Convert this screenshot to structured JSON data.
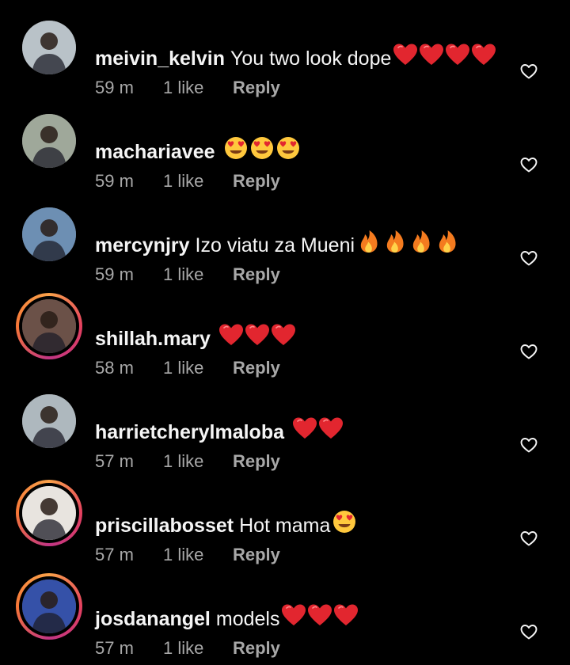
{
  "comments": [
    {
      "username": "meivin_kelvin",
      "text": "You two look dope",
      "emoji": "heart",
      "emoji_count": 4,
      "time": "59 m",
      "likes": "1 like",
      "reply_label": "Reply",
      "story_ring": false,
      "avatar_color": "#b9c2c8"
    },
    {
      "username": "machariavee",
      "text": "",
      "emoji": "heart-eyes",
      "emoji_count": 3,
      "time": "59 m",
      "likes": "1 like",
      "reply_label": "Reply",
      "story_ring": false,
      "avatar_color": "#9fa89a"
    },
    {
      "username": "mercynjry",
      "text": "Izo viatu za Mueni",
      "emoji": "fire",
      "emoji_count": 4,
      "time": "59 m",
      "likes": "1 like",
      "reply_label": "Reply",
      "story_ring": false,
      "avatar_color": "#6d8fb3"
    },
    {
      "username": "shillah.mary",
      "text": "",
      "emoji": "heart",
      "emoji_count": 3,
      "time": "58 m",
      "likes": "1 like",
      "reply_label": "Reply",
      "story_ring": true,
      "avatar_color": "#6b5148"
    },
    {
      "username": "harrietcherylmaloba",
      "text": "",
      "emoji": "heart",
      "emoji_count": 2,
      "time": "57 m",
      "likes": "1 like",
      "reply_label": "Reply",
      "story_ring": false,
      "avatar_color": "#aeb8be"
    },
    {
      "username": "priscillabosset",
      "text": "Hot mama",
      "emoji": "heart-eyes",
      "emoji_count": 1,
      "time": "57 m",
      "likes": "1 like",
      "reply_label": "Reply",
      "story_ring": true,
      "avatar_color": "#e8e4df"
    },
    {
      "username": "josdanangel",
      "text": "models",
      "emoji": "heart",
      "emoji_count": 3,
      "time": "57 m",
      "likes": "1 like",
      "reply_label": "Reply",
      "story_ring": true,
      "avatar_color": "#3551a8"
    }
  ],
  "colors": {
    "background": "#000000",
    "text": "#f5f5f5",
    "meta": "#a8a8a8",
    "heart_emoji": "#e2262f",
    "story_ring": "#e4405f"
  },
  "icons": {
    "like": "heart-outline-icon",
    "heart": "red-heart-emoji",
    "heart-eyes": "heart-eyes-emoji",
    "fire": "fire-emoji"
  }
}
